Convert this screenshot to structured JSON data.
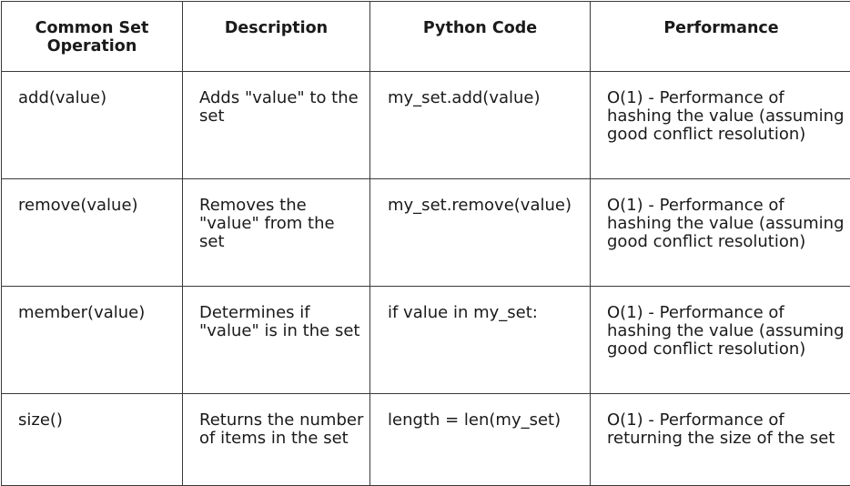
{
  "table": {
    "headers": [
      "Common Set Operation",
      "Description",
      "Python Code",
      "Performance"
    ],
    "rows": [
      {
        "operation": "add(value)",
        "description": "Adds \"value\" to the set",
        "code": "my_set.add(value)",
        "performance": "O(1) - Performance of hashing the value (assuming good conflict resolution)"
      },
      {
        "operation": "remove(value)",
        "description": "Removes the \"value\" from the set",
        "code": "my_set.remove(value)",
        "performance": "O(1) - Performance of hashing the value (assuming good conflict resolution)"
      },
      {
        "operation": "member(value)",
        "description": "Determines if \"value\" is in the set",
        "code": "if value in my_set:",
        "performance": "O(1) - Performance of hashing the value (assuming good conflict resolution)"
      },
      {
        "operation": "size()",
        "description": "Returns the number of items in the set",
        "code": "length = len(my_set)",
        "performance": "O(1) - Performance of returning the size of the set"
      }
    ]
  }
}
